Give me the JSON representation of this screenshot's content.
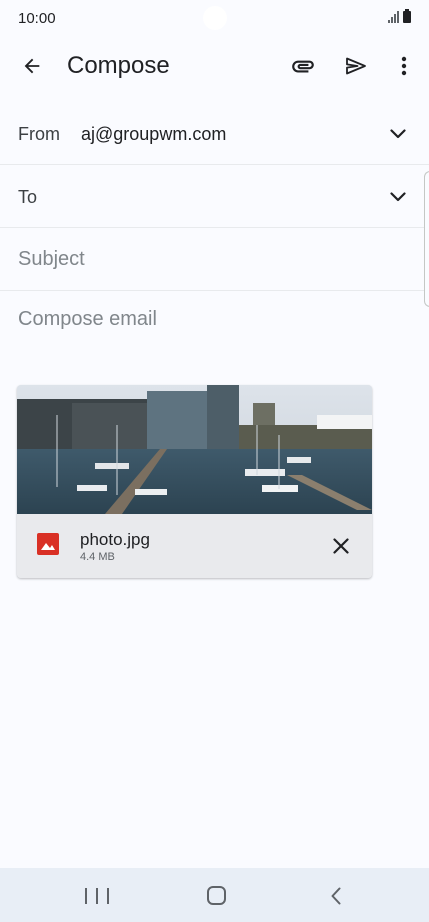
{
  "status_bar": {
    "time": "10:00",
    "icons": [
      "signal-icon",
      "battery-icon"
    ]
  },
  "app_bar": {
    "title": "Compose",
    "icons": [
      "arrow-back-icon",
      "paperclip-icon",
      "send-icon",
      "more-vert-icon"
    ]
  },
  "form": {
    "from_label": "From",
    "from_value": "aj@groupwm.com",
    "to_label": "To",
    "subject_placeholder": "Subject",
    "body_placeholder": "Compose email"
  },
  "attachment": {
    "file_name": "photo.jpg",
    "file_size": "4.4 MB",
    "icon": "image-file-icon",
    "icon_color": "#d93025"
  },
  "nav_bar": {
    "icons": [
      "recents-icon",
      "home-icon",
      "back-icon"
    ]
  },
  "colors": {
    "background": "#fafbff",
    "nav_background": "#e8eef6",
    "attachment_background": "#e9eaed"
  }
}
